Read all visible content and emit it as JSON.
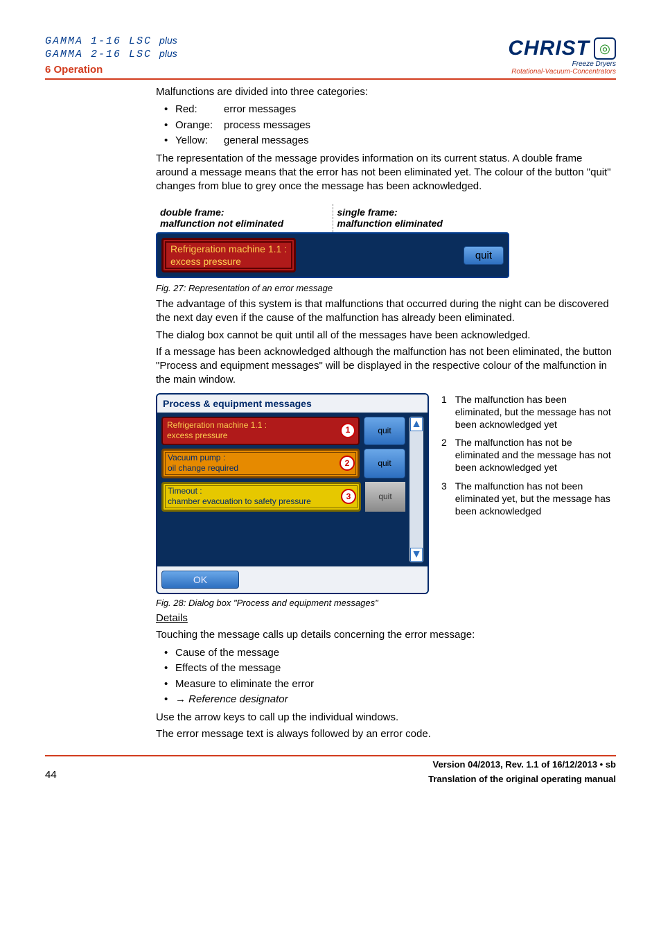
{
  "header": {
    "model1": "GAMMA 1-16 LSC",
    "model2": "GAMMA 2-16 LSC",
    "plus": "plus",
    "section": "6 Operation",
    "logo_text": "CHRIST",
    "logo_sub1": "Freeze Dryers",
    "logo_sub2": "Rotational-Vacuum-Concentrators"
  },
  "intro": {
    "line1": "Malfunctions are divided into three categories:",
    "bullets": [
      {
        "label": "Red:",
        "desc": "error messages"
      },
      {
        "label": "Orange:",
        "desc": "process messages"
      },
      {
        "label": "Yellow:",
        "desc": "general messages"
      }
    ],
    "para2": "The representation of the message provides information on its current status. A double frame around a message means that the error has not been eliminated yet. The colour of the button \"quit\" changes from blue to grey once the message has been acknowledged."
  },
  "fig27": {
    "col1a": "double frame:",
    "col1b": "malfunction not eliminated",
    "col2a": "single frame:",
    "col2b": "malfunction eliminated",
    "msg_line1": "Refrigeration machine 1.1 :",
    "msg_line2": "excess pressure",
    "quit": "quit",
    "caption": "Fig. 27: Representation of an error message"
  },
  "mid": {
    "p1": "The advantage of this system is that malfunctions that occurred during the night can be discovered the next day even if the cause of the malfunction has already been eliminated.",
    "p2": "The dialog box cannot be quit until all of the messages have been acknowledged.",
    "p3": "If a message has been acknowledged although the malfunction has not been eliminated, the button \"Process and equipment messages\" will be displayed in the respective colour of the malfunction in the main window."
  },
  "fig28": {
    "title": "Process & equipment messages",
    "rows": [
      {
        "l1": "Refrigeration machine 1.1 :",
        "l2": "excess pressure",
        "num": "1",
        "quit": "quit",
        "style": "msg-red-single",
        "qstyle": "quit-btn"
      },
      {
        "l1": "Vacuum pump :",
        "l2": "oil change required",
        "num": "2",
        "quit": "quit",
        "style": "msg-orange",
        "qstyle": "quit-btn"
      },
      {
        "l1": "Timeout :",
        "l2": "chamber evacuation to safety pressure",
        "num": "3",
        "quit": "quit",
        "style": "msg-yellow",
        "qstyle": "quit-gray"
      }
    ],
    "ok": "OK",
    "caption": "Fig. 28: Dialog box \"Process and equipment messages\""
  },
  "legend": {
    "items": [
      {
        "n": "1",
        "t": "The malfunction has been eliminated, but the message has not been acknowledged yet"
      },
      {
        "n": "2",
        "t": "The malfunction has not be eliminated and the message has not been acknowledged yet"
      },
      {
        "n": "3",
        "t": "The malfunction has not been eliminated yet, but the message has been acknowledged"
      }
    ]
  },
  "details": {
    "heading": "Details",
    "lead": "Touching the message calls up details concerning the error message:",
    "items": [
      "Cause of the message",
      "Effects of the message",
      "Measure to eliminate the error"
    ],
    "ref": "Reference designator",
    "tail1": "Use the arrow keys to call up the individual windows.",
    "tail2": "The error message text is always followed by an error code."
  },
  "footer": {
    "page": "44",
    "version": "Version 04/2013, Rev. 1.1 of 16/12/2013 • sb",
    "trans": "Translation of the original operating manual"
  }
}
